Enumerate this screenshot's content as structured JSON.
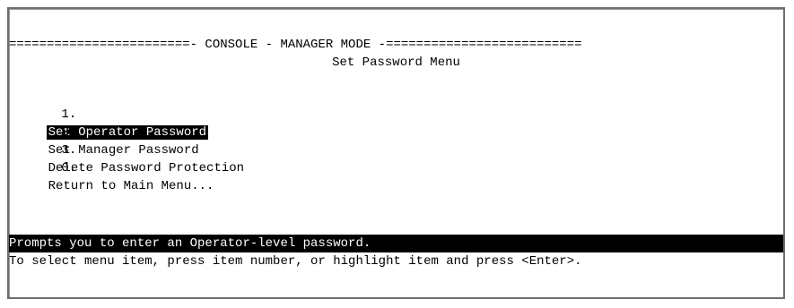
{
  "console": {
    "banner": "========================- CONSOLE - MANAGER MODE -==========================",
    "subtitle": "Set Password Menu"
  },
  "menu": {
    "items": [
      {
        "number": "1.",
        "label": "Set Operator Password",
        "selected": true
      },
      {
        "number": "2.",
        "label": "Set Manager Password",
        "selected": false
      },
      {
        "number": "3.",
        "label": "Delete Password Protection",
        "selected": false
      },
      {
        "number": "0.",
        "label": "Return to Main Menu...",
        "selected": false
      }
    ]
  },
  "status": {
    "help_text": "Prompts you to enter an Operator-level password.",
    "instructions": "To select menu item, press item number, or highlight item and press <Enter>."
  },
  "colors": {
    "background": "#ffffff",
    "foreground": "#000000",
    "highlight_bg": "#000000",
    "highlight_fg": "#ffffff"
  }
}
